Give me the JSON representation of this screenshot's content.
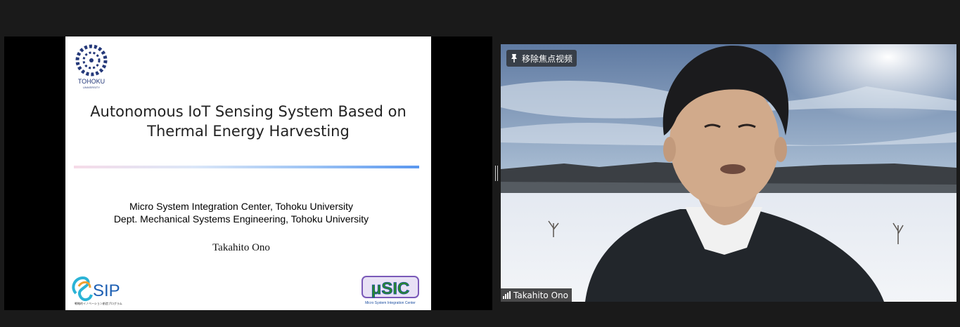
{
  "share": {
    "slide": {
      "logo_text": "TOHOKU",
      "logo_subtext": "UNIVERSITY",
      "title_line1": "Autonomous IoT Sensing System Based on",
      "title_line2": "Thermal Energy Harvesting",
      "affiliation_line1": "Micro System Integration Center, Tohoku University",
      "affiliation_line2": "Dept. Mechanical Systems Engineering, Tohoku University",
      "author": "Takahito Ono",
      "sip_logo_text": "SIP",
      "sip_caption": "戦略的イノベーション創造プログラム",
      "usic_logo_text": "μSIC",
      "usic_caption": "Micro System Integration Center"
    }
  },
  "video": {
    "unpin_label": "移除焦点视频",
    "participant_name": "Takahito Ono",
    "icons": {
      "unpin": "pin-icon",
      "signal": "signal-strength-icon"
    }
  },
  "colors": {
    "background": "#1a1a1a",
    "divider_end": "#5a97ef"
  }
}
